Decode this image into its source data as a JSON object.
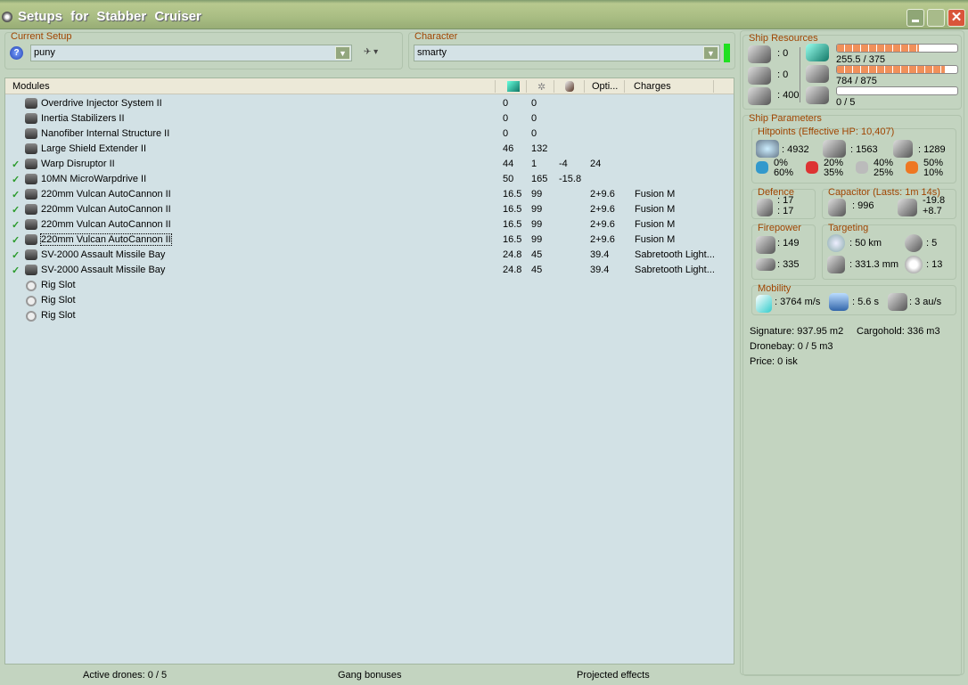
{
  "window": {
    "title": "Setups for Stabber Cruiser"
  },
  "setup": {
    "label": "Current Setup",
    "value": "puny"
  },
  "character": {
    "label": "Character",
    "value": "smarty"
  },
  "columns": {
    "modules": "Modules",
    "opti": "Opti...",
    "charges": "Charges"
  },
  "modules": [
    {
      "checked": false,
      "name": "Overdrive Injector System II",
      "cpu": "0",
      "pg": "0",
      "cap": "",
      "opti": "",
      "charges": ""
    },
    {
      "checked": false,
      "name": "Inertia Stabilizers II",
      "cpu": "0",
      "pg": "0",
      "cap": "",
      "opti": "",
      "charges": ""
    },
    {
      "checked": false,
      "name": "Nanofiber Internal Structure II",
      "cpu": "0",
      "pg": "0",
      "cap": "",
      "opti": "",
      "charges": ""
    },
    {
      "checked": false,
      "name": "Large Shield Extender II",
      "cpu": "46",
      "pg": "132",
      "cap": "",
      "opti": "",
      "charges": ""
    },
    {
      "checked": true,
      "name": "Warp Disruptor II",
      "cpu": "44",
      "pg": "1",
      "cap": "-4",
      "opti": "24",
      "charges": ""
    },
    {
      "checked": true,
      "name": "10MN MicroWarpdrive II",
      "cpu": "50",
      "pg": "165",
      "cap": "-15.8",
      "opti": "",
      "charges": ""
    },
    {
      "checked": true,
      "name": "220mm Vulcan AutoCannon II",
      "cpu": "16.5",
      "pg": "99",
      "cap": "",
      "opti": "2+9.6",
      "charges": "Fusion M"
    },
    {
      "checked": true,
      "name": "220mm Vulcan AutoCannon II",
      "cpu": "16.5",
      "pg": "99",
      "cap": "",
      "opti": "2+9.6",
      "charges": "Fusion M"
    },
    {
      "checked": true,
      "name": "220mm Vulcan AutoCannon II",
      "cpu": "16.5",
      "pg": "99",
      "cap": "",
      "opti": "2+9.6",
      "charges": "Fusion M"
    },
    {
      "checked": true,
      "name": "220mm Vulcan AutoCannon II",
      "cpu": "16.5",
      "pg": "99",
      "cap": "",
      "opti": "2+9.6",
      "charges": "Fusion M",
      "selected": true
    },
    {
      "checked": true,
      "name": "SV-2000 Assault Missile Bay",
      "cpu": "24.8",
      "pg": "45",
      "cap": "",
      "opti": "39.4",
      "charges": "Sabretooth Light..."
    },
    {
      "checked": true,
      "name": "SV-2000 Assault Missile Bay",
      "cpu": "24.8",
      "pg": "45",
      "cap": "",
      "opti": "39.4",
      "charges": "Sabretooth Light..."
    },
    {
      "checked": false,
      "name": "Rig Slot",
      "rig": true,
      "cpu": "",
      "pg": "",
      "cap": "",
      "opti": "",
      "charges": ""
    },
    {
      "checked": false,
      "name": "Rig Slot",
      "rig": true,
      "cpu": "",
      "pg": "",
      "cap": "",
      "opti": "",
      "charges": ""
    },
    {
      "checked": false,
      "name": "Rig Slot",
      "rig": true,
      "cpu": "",
      "pg": "",
      "cap": "",
      "opti": "",
      "charges": ""
    }
  ],
  "status": {
    "drones": "Active drones: 0 / 5",
    "gang": "Gang bonuses",
    "projected": "Projected effects"
  },
  "resources": {
    "label": "Ship Resources",
    "turrets": ": 0",
    "launchers": ": 0",
    "calibration": ": 400",
    "cpu": {
      "text": "255.5 / 375",
      "fraction": 0.681
    },
    "powergrid": {
      "text": "784 / 875",
      "fraction": 0.896
    },
    "drones": {
      "text": "0 / 5",
      "fraction": 0
    }
  },
  "parameters": {
    "label": "Ship Parameters",
    "hitpoints": {
      "label": "Hitpoints (Effective HP: 10,407)",
      "shield": ": 4932",
      "armor": ": 1563",
      "structure": ": 1289",
      "resists": [
        {
          "type": "em",
          "a": "0%",
          "b": "60%"
        },
        {
          "type": "thermal",
          "a": "20%",
          "b": "35%"
        },
        {
          "type": "kinetic",
          "a": "40%",
          "b": "25%"
        },
        {
          "type": "explosive",
          "a": "50%",
          "b": "10%"
        }
      ]
    },
    "defence": {
      "label": "Defence",
      "a": ": 17",
      "b": ": 17"
    },
    "capacitor": {
      "label": "Capacitor (Lasts: 1m 14s)",
      "capacity": ": 996",
      "use": "-19.8",
      "recharge": "+8.7"
    },
    "firepower": {
      "label": "Firepower",
      "turret": ": 149",
      "missile": ": 335"
    },
    "targeting": {
      "label": "Targeting",
      "range": ": 50 km",
      "targets": ": 5",
      "resolution": ": 331.3 mm",
      "sensor": ": 13"
    },
    "mobility": {
      "label": "Mobility",
      "speed": ": 3764 m/s",
      "align": ": 5.6 s",
      "warp": ": 3 au/s"
    }
  },
  "info": {
    "signature": "Signature: 937.95 m2",
    "cargo": "Cargohold: 336 m3",
    "dronebay": "Dronebay: 0 / 5 m3",
    "price": "Price: 0 isk"
  },
  "colors": {
    "accent": "#a04400",
    "title": "#a9bd83",
    "list": "#d2e1e5",
    "close": "#d9553a"
  }
}
